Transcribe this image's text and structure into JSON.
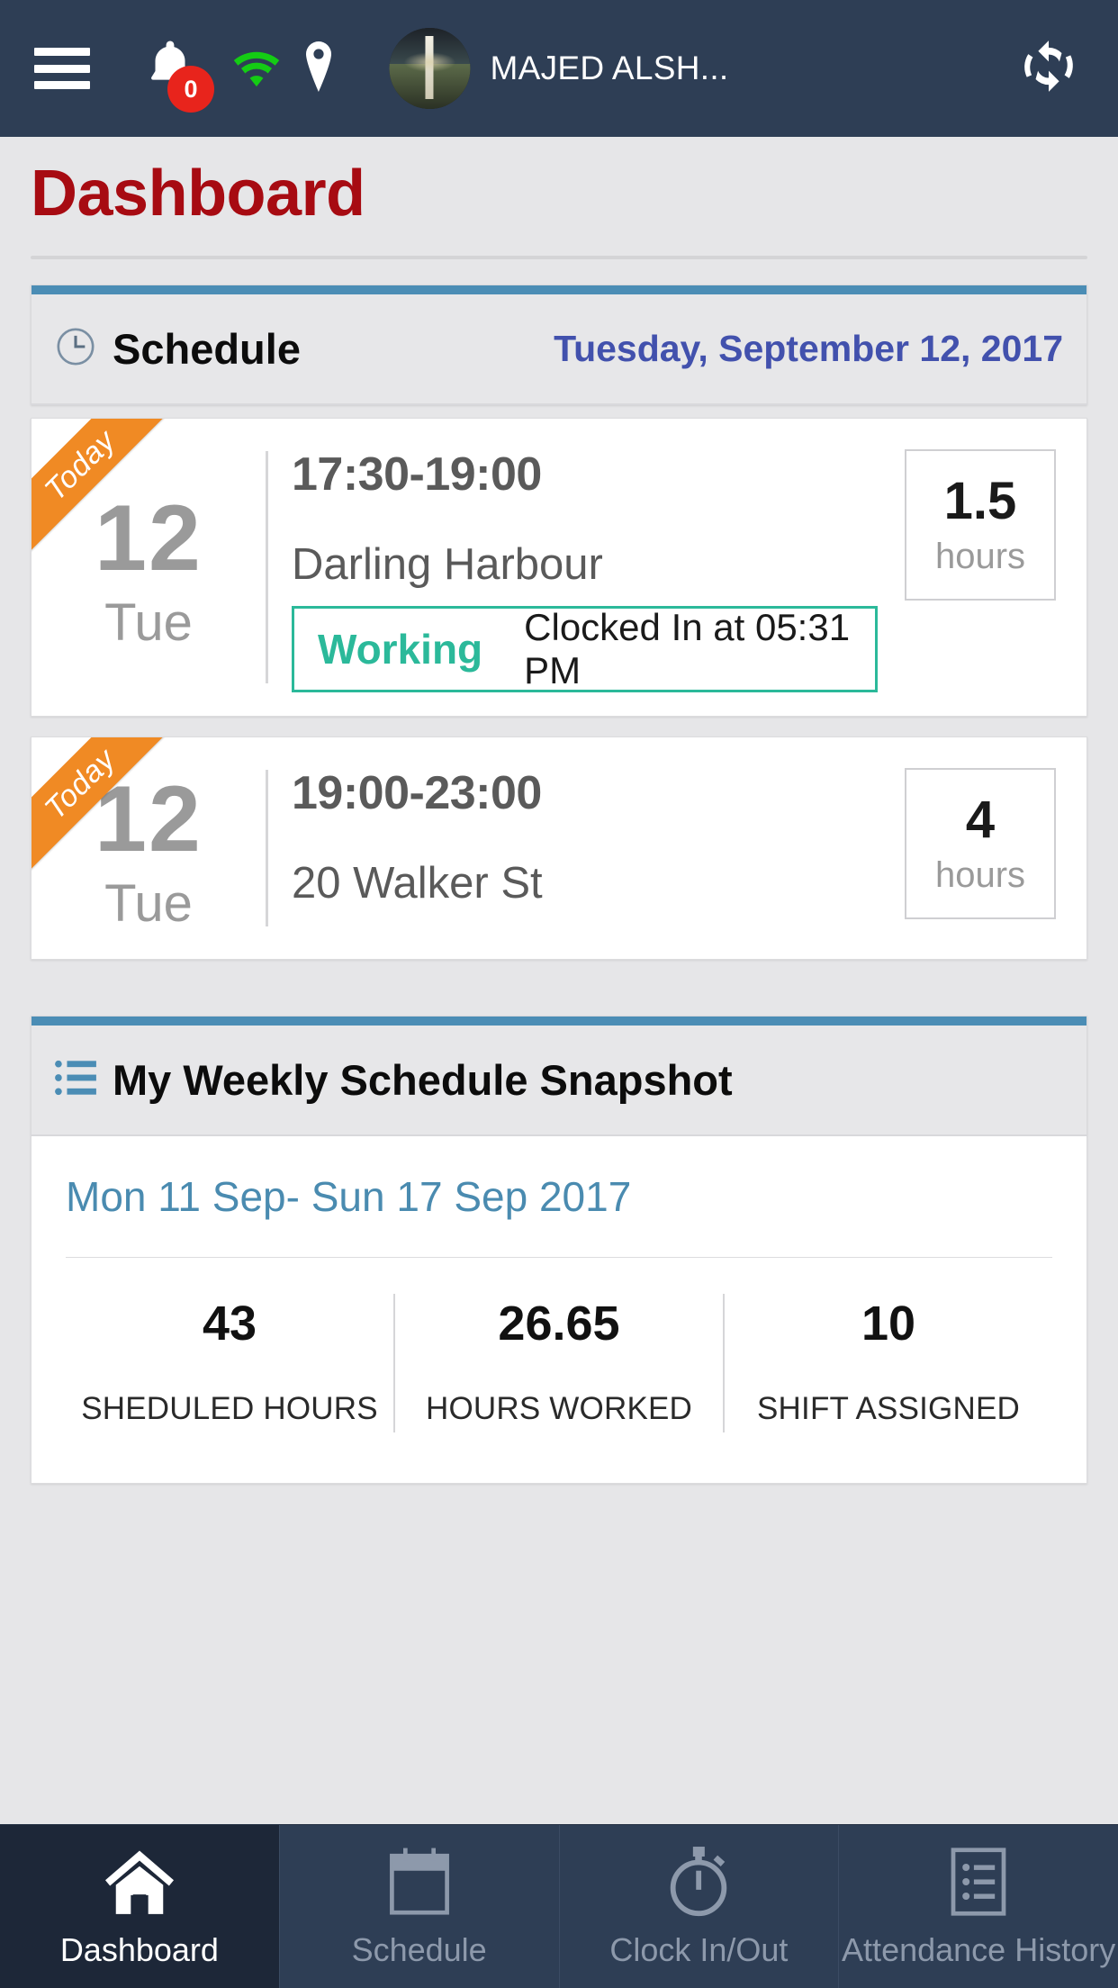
{
  "topbar": {
    "menu_icon": "hamburger-menu-icon",
    "notification_icon": "bell-icon",
    "notification_count": "0",
    "wifi_icon": "wifi-icon",
    "location_icon": "location-pin-icon",
    "avatar_icon": "user-avatar",
    "username": "MAJED ALSH...",
    "refresh_icon": "refresh-icon"
  },
  "page": {
    "title": "Dashboard"
  },
  "schedule_panel": {
    "icon": "clock-icon",
    "title": "Schedule",
    "date": "Tuesday, September 12, 2017",
    "accent_color": "#4b8db5",
    "shifts": [
      {
        "ribbon": "Today",
        "day": "12",
        "dow": "Tue",
        "time": "17:30-19:00",
        "location": "Darling Harbour",
        "hours_value": "1.5",
        "hours_unit": "hours",
        "status_label": "Working",
        "status_text": "Clocked In at 05:31 PM",
        "status_color": "#2bb99a"
      },
      {
        "ribbon": "Today",
        "day": "12",
        "dow": "Tue",
        "time": "19:00-23:00",
        "location": "20 Walker St",
        "hours_value": "4",
        "hours_unit": "hours",
        "status_label": "",
        "status_text": ""
      }
    ]
  },
  "snapshot_panel": {
    "icon": "list-icon",
    "title": "My Weekly Schedule Snapshot",
    "range": "Mon 11 Sep- Sun 17 Sep 2017",
    "range_color": "#4a8bb0",
    "stats": [
      {
        "value": "43",
        "label": "SHEDULED HOURS"
      },
      {
        "value": "26.65",
        "label": "HOURS WORKED"
      },
      {
        "value": "10",
        "label": "SHIFT ASSIGNED"
      }
    ]
  },
  "bottomnav": {
    "items": [
      {
        "label": "Dashboard",
        "icon": "home-icon",
        "active": true
      },
      {
        "label": "Schedule",
        "icon": "calendar-icon",
        "active": false
      },
      {
        "label": "Clock In/Out",
        "icon": "stopwatch-icon",
        "active": false
      },
      {
        "label": "Attendance History",
        "icon": "list-document-icon",
        "active": false
      }
    ]
  }
}
